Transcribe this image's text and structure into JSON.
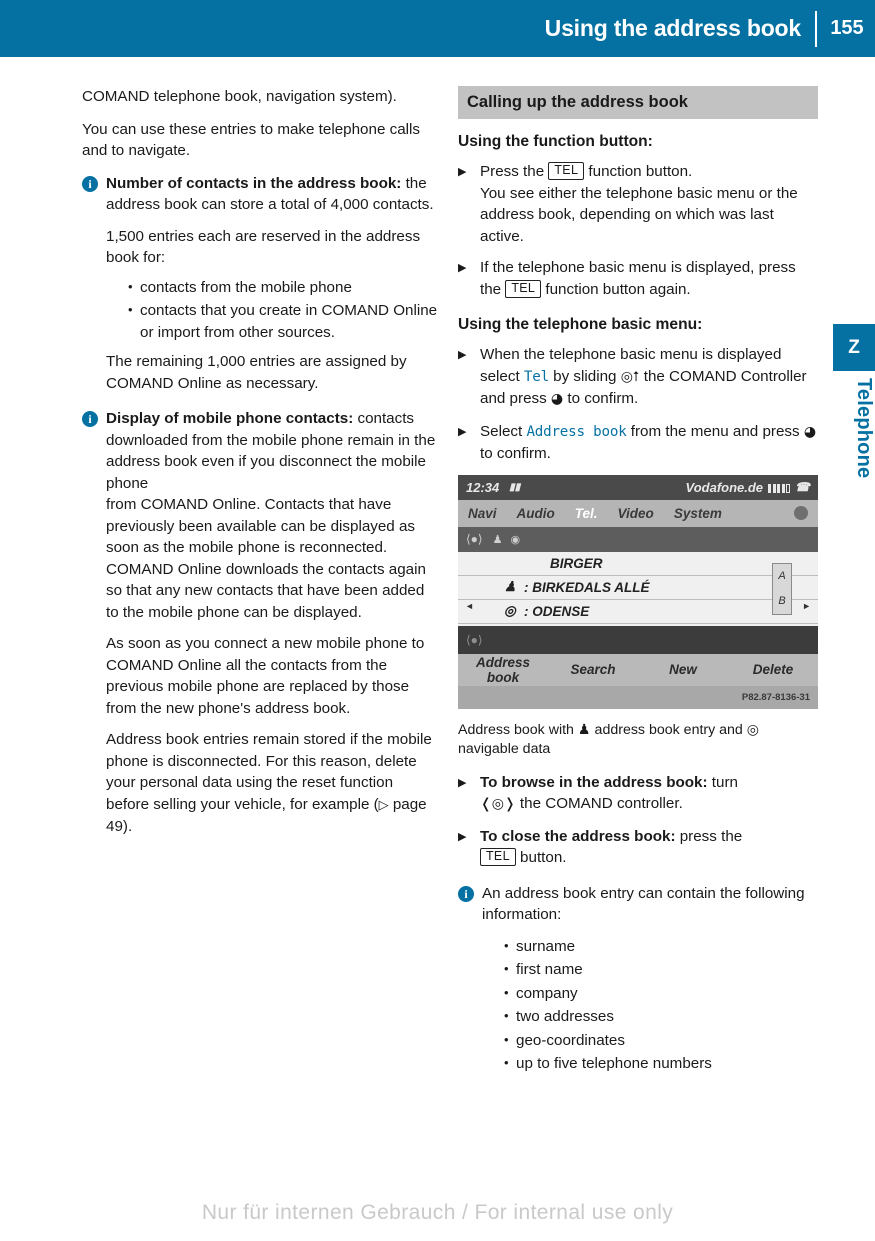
{
  "header": {
    "title": "Using the address book",
    "page_number": "155",
    "accent_color": "#0571a3"
  },
  "side_tab": {
    "marker": "Z",
    "label": "Telephone"
  },
  "left_column": {
    "para_1": "COMAND telephone book, navigation system).",
    "para_2": "You can use these entries to make telephone calls and to navigate.",
    "note_1": {
      "icon": "info-icon",
      "lead_bold": "Number of contacts in the address book:",
      "lead_rest": " the address book can store a total of 4,000 contacts.",
      "sub_1": "1,500 entries each are reserved in the address book for:",
      "bullets": [
        "contacts from the mobile phone",
        "contacts that you create in COMAND Online or import from other sources."
      ],
      "sub_2": "The remaining 1,000 entries are assigned by COMAND Online as necessary."
    },
    "note_2": {
      "icon": "info-icon",
      "lead_bold": "Display of mobile phone contacts:",
      "lead_rest": " contacts downloaded from the mobile phone remain in the address book even if you disconnect the mobile phone",
      "sub_1": "from COMAND Online. Contacts that have previously been available can be displayed as soon as the mobile phone is reconnected. COMAND Online downloads the contacts again so that any new contacts that have been added to the mobile phone can be displayed.",
      "sub_2": "As soon as you connect a new mobile phone to COMAND Online all the contacts from the previous mobile phone are replaced by those from the new phone's address book.",
      "sub_3_a": "Address book entries remain stored if the mobile phone is disconnected. For this reason, delete your personal data using the reset function before selling your vehicle, for example (",
      "sub_3_ref": "page 49",
      "sub_3_b": ")."
    }
  },
  "right_column": {
    "section_title": "Calling up the address book",
    "subhead_1": "Using the function button:",
    "step_1": {
      "a": "Press the ",
      "key": "TEL",
      "b": " function button.",
      "detail": "You see either the telephone basic menu or the address book, depending on which was last active."
    },
    "step_2": {
      "a": "If the telephone basic menu is displayed, press the ",
      "key": "TEL",
      "b": " function button again."
    },
    "subhead_2": "Using the telephone basic menu:",
    "step_3": {
      "a": "When the telephone basic menu is displayed select ",
      "term": "Tel",
      "b": " by sliding ",
      "glyph_slide": "◎⭡",
      "c": " the COMAND Controller and press ",
      "glyph_press": "◕",
      "d": " to confirm."
    },
    "step_4": {
      "a": "Select ",
      "term": "Address book",
      "b": " from the menu and press ",
      "glyph_press": "◕",
      "c": " to confirm."
    },
    "caption": {
      "a": "Address book with ",
      "icon_1": "person-icon",
      "b": " address book entry and ",
      "icon_2": "compass-icon",
      "c": " navigable data"
    },
    "step_5": {
      "bold": "To browse in the address book:",
      "a": " turn ",
      "glyph_turn": "❬◎❭",
      "b": " the COMAND controller."
    },
    "step_6": {
      "bold": "To close the address book:",
      "a": " press the ",
      "key": "TEL",
      "b": " button."
    },
    "note_3": {
      "icon": "info-icon",
      "text": "An address book entry can contain the following information:",
      "bullets": [
        "surname",
        "first name",
        "company",
        "two addresses",
        "geo-coordinates",
        "up to five telephone numbers"
      ]
    }
  },
  "comand_screenshot": {
    "status_time": "12:34",
    "status_icon": "phone-signal-icon",
    "status_network": "Vodafone.de",
    "status_call_icon": "handset-icon",
    "menu_items": [
      "Navi",
      "Audio",
      "Tel.",
      "Video",
      "System"
    ],
    "menu_active": "Tel.",
    "rows": [
      {
        "icon": "",
        "text": "BIRGER"
      },
      {
        "icon": "person-icon",
        "text": ": BIRKEDALS ALLÉ"
      },
      {
        "icon": "nav-icon",
        "text": ": ODENSE"
      }
    ],
    "letter_index": [
      "A",
      "B"
    ],
    "bottom_items": [
      "Address book",
      "Search",
      "New",
      "Delete"
    ],
    "image_code": "P82.87-8136-31"
  },
  "footer": {
    "watermark": "Nur für internen Gebrauch / For internal use only"
  }
}
